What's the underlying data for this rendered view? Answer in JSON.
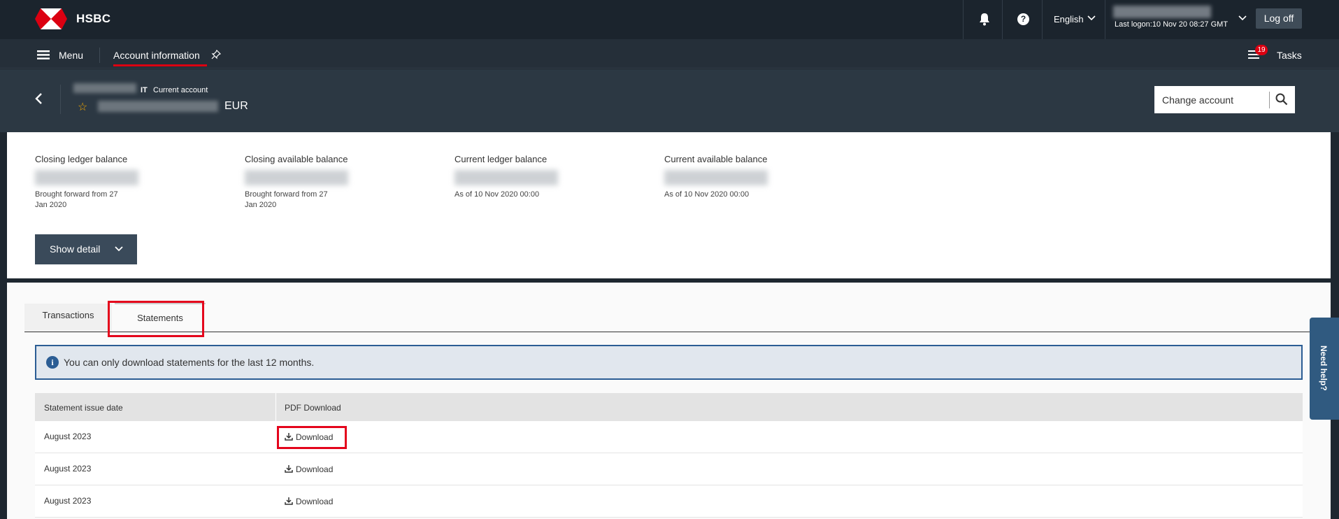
{
  "topbar": {
    "brand": "HSBC",
    "language": "English",
    "last_logon": "Last logon:10 Nov 20 08:27 GMT",
    "logoff": "Log off",
    "icons": [
      "hsbc-logo",
      "bell-icon",
      "help-icon",
      "chevron-down-icon"
    ]
  },
  "navbar": {
    "menu": "Menu",
    "active_page": "Account information",
    "tasks_label": "Tasks",
    "tasks_count": "19"
  },
  "account": {
    "country": "IT",
    "type": "Current account",
    "currency": "EUR",
    "change_account": "Change account"
  },
  "balances": [
    {
      "label": "Closing ledger balance",
      "sub": "Brought forward from 27 Jan 2020"
    },
    {
      "label": "Closing available balance",
      "sub": "Brought forward from 27 Jan 2020"
    },
    {
      "label": "Current ledger balance",
      "sub": "As of 10 Nov 2020 00:00"
    },
    {
      "label": "Current available balance",
      "sub": "As of 10 Nov 2020 00:00"
    }
  ],
  "show_detail": "Show detail",
  "tabs": [
    "Transactions",
    "Statements"
  ],
  "active_tab": "Statements",
  "notice": "You can only download statements for the last 12 months.",
  "table": {
    "headers": [
      "Statement issue date",
      "PDF Download"
    ],
    "rows": [
      {
        "date": "August 2023",
        "action": "Download"
      },
      {
        "date": "August 2023",
        "action": "Download"
      },
      {
        "date": "August 2023",
        "action": "Download"
      }
    ]
  },
  "need_help": "Need help?",
  "colors": {
    "brand_red": "#db0011",
    "highlight": "#e4051c",
    "topbar": "#1b242d",
    "notice_border": "#2b5d94"
  }
}
